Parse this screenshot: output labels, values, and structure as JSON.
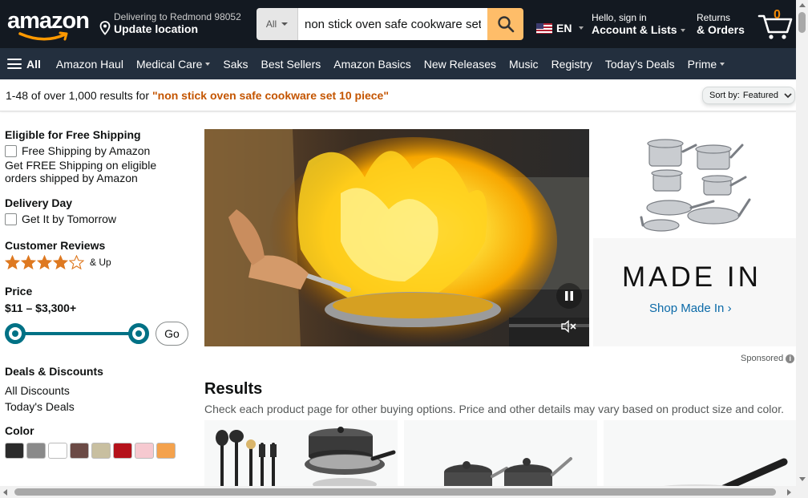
{
  "header": {
    "logo_text": "amazon",
    "location": {
      "line1": "Delivering to Redmond 98052",
      "line2": "Update location"
    },
    "search": {
      "category": "All",
      "query": "non stick oven safe cookware set 10 piece"
    },
    "language": "EN",
    "account": {
      "line1": "Hello, sign in",
      "line2": "Account & Lists"
    },
    "returns": {
      "line1": "Returns",
      "line2": "& Orders"
    },
    "cart_count": "0"
  },
  "subnav": {
    "all_label": "All",
    "items": [
      "Amazon Haul",
      "Medical Care",
      "Saks",
      "Best Sellers",
      "Amazon Basics",
      "New Releases",
      "Music",
      "Registry",
      "Today's Deals",
      "Prime"
    ]
  },
  "results_bar": {
    "count_text": "1-48 of over 1,000 results for",
    "query_text": "\"non stick oven safe cookware set 10 piece\"",
    "sort_label": "Sort by:",
    "sort_value": "Featured"
  },
  "filters": {
    "free_shipping": {
      "heading": "Eligible for Free Shipping",
      "option": "Free Shipping by Amazon",
      "note": "Get FREE Shipping on eligible orders shipped by Amazon"
    },
    "delivery": {
      "heading": "Delivery Day",
      "option": "Get It by Tomorrow"
    },
    "reviews": {
      "heading": "Customer Reviews",
      "stars": 4,
      "suffix": "& Up"
    },
    "price": {
      "heading": "Price",
      "range": "$11 – $3,300+",
      "go_label": "Go",
      "slider_min_fraction": 0,
      "slider_max_fraction": 1
    },
    "deals": {
      "heading": "Deals & Discounts",
      "links": [
        "All Discounts",
        "Today's Deals"
      ]
    },
    "color": {
      "heading": "Color",
      "swatches": [
        "#2b2b2b",
        "#8a8a8a",
        "#ffffff",
        "#6b4a45",
        "#c8bfa0",
        "#b5121b",
        "#f6c9d0",
        "#f4a24d"
      ]
    }
  },
  "ad": {
    "brand": "MADE IN",
    "link": "Shop Made In ›",
    "sponsored": "Sponsored"
  },
  "results": {
    "heading": "Results",
    "subheading": "Check each product page for other buying options. Price and other details may vary based on product size and color."
  }
}
